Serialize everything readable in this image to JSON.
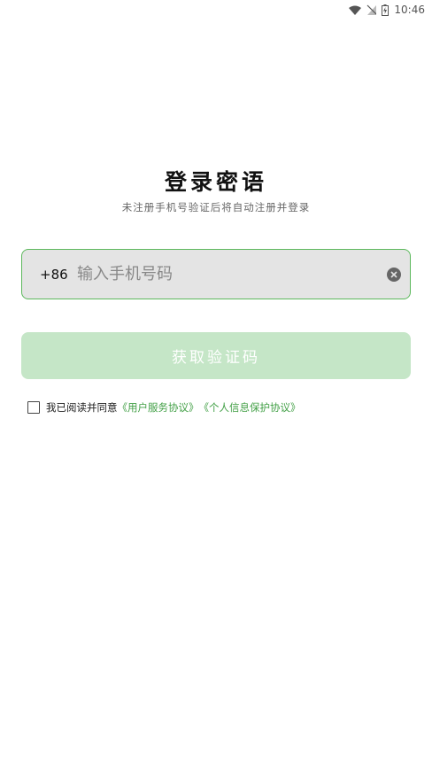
{
  "status_bar": {
    "time": "10:46",
    "icons": [
      "wifi-icon",
      "no-signal-icon",
      "battery-charging-icon"
    ]
  },
  "login": {
    "title": "登录密语",
    "subtitle": "未注册手机号验证后将自动注册并登录",
    "country_code": "+86",
    "phone_placeholder": "输入手机号码",
    "phone_value": "",
    "get_code_label": "获取验证码"
  },
  "agreement": {
    "checked": false,
    "prefix": "我已阅读并同意",
    "user_agreement": "《用户服务协议》",
    "privacy_agreement": "《个人信息保护协议》"
  },
  "colors": {
    "accent": "#43a047",
    "input_border": "#5cb85c",
    "button_disabled_bg": "#c5e6c7",
    "input_bg": "#e4e4e4"
  }
}
